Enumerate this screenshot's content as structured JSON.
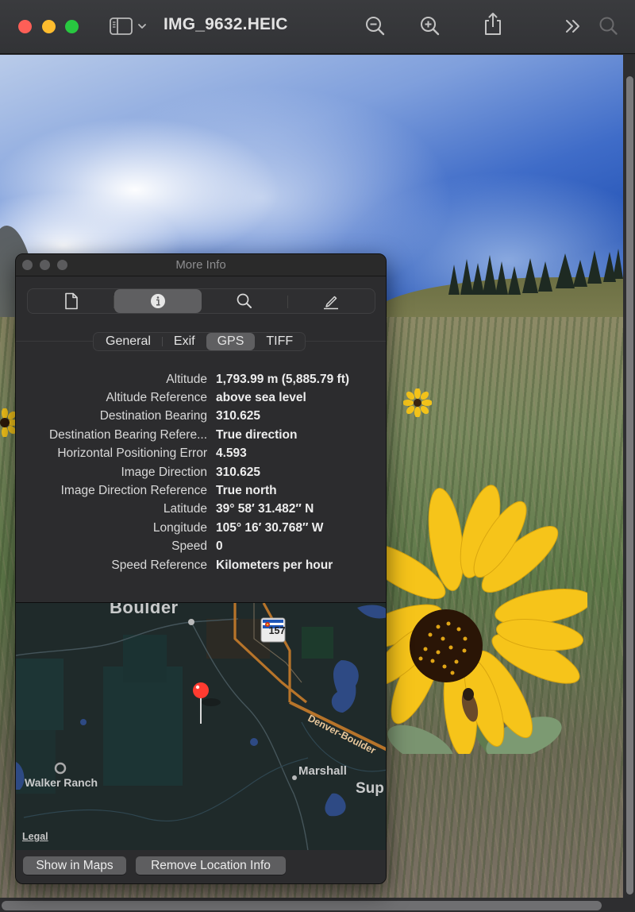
{
  "window": {
    "title": "IMG_9632.HEIC",
    "toolbar": {
      "sidebar_toggle": "sidebar-icon",
      "zoom_out": "zoom-out-icon",
      "zoom_in": "zoom-in-icon",
      "share": "share-icon",
      "more": "chevron-double-right-icon",
      "search": "search-icon"
    }
  },
  "panel": {
    "title": "More Info",
    "segments": [
      {
        "icon": "document-icon",
        "active": false
      },
      {
        "icon": "info-icon",
        "active": true
      },
      {
        "icon": "search-icon",
        "active": false
      },
      {
        "icon": "pencil-icon",
        "active": false
      }
    ],
    "subtabs": [
      {
        "label": "General",
        "active": false
      },
      {
        "label": "Exif",
        "active": false
      },
      {
        "label": "GPS",
        "active": true
      },
      {
        "label": "TIFF",
        "active": false
      }
    ],
    "gps": [
      {
        "key": "Altitude",
        "value": "1,793.99 m (5,885.79 ft)"
      },
      {
        "key": "Altitude Reference",
        "value": "above sea level"
      },
      {
        "key": "Destination Bearing",
        "value": "310.625"
      },
      {
        "key": "Destination Bearing Refere...",
        "value": "True direction"
      },
      {
        "key": "Horizontal Positioning Error",
        "value": "4.593"
      },
      {
        "key": "Image Direction",
        "value": "310.625"
      },
      {
        "key": "Image Direction Reference",
        "value": "True north"
      },
      {
        "key": "Latitude",
        "value": "39° 58′ 31.482″ N"
      },
      {
        "key": "Longitude",
        "value": "105° 16′ 30.768″ W"
      },
      {
        "key": "Speed",
        "value": "0"
      },
      {
        "key": "Speed Reference",
        "value": "Kilometers per hour"
      }
    ],
    "map": {
      "labels": {
        "boulder": "Boulder",
        "walker_ranch": "Walker Ranch",
        "marshall": "Marshall",
        "superior": "Sup",
        "road": "Denver-Boulder",
        "highway_shield": "157"
      },
      "legal": "Legal",
      "pin_color": "#ff3b30",
      "road_color": "#b7742a"
    },
    "buttons": {
      "show_in_maps": "Show in Maps",
      "remove_location": "Remove Location Info"
    }
  }
}
